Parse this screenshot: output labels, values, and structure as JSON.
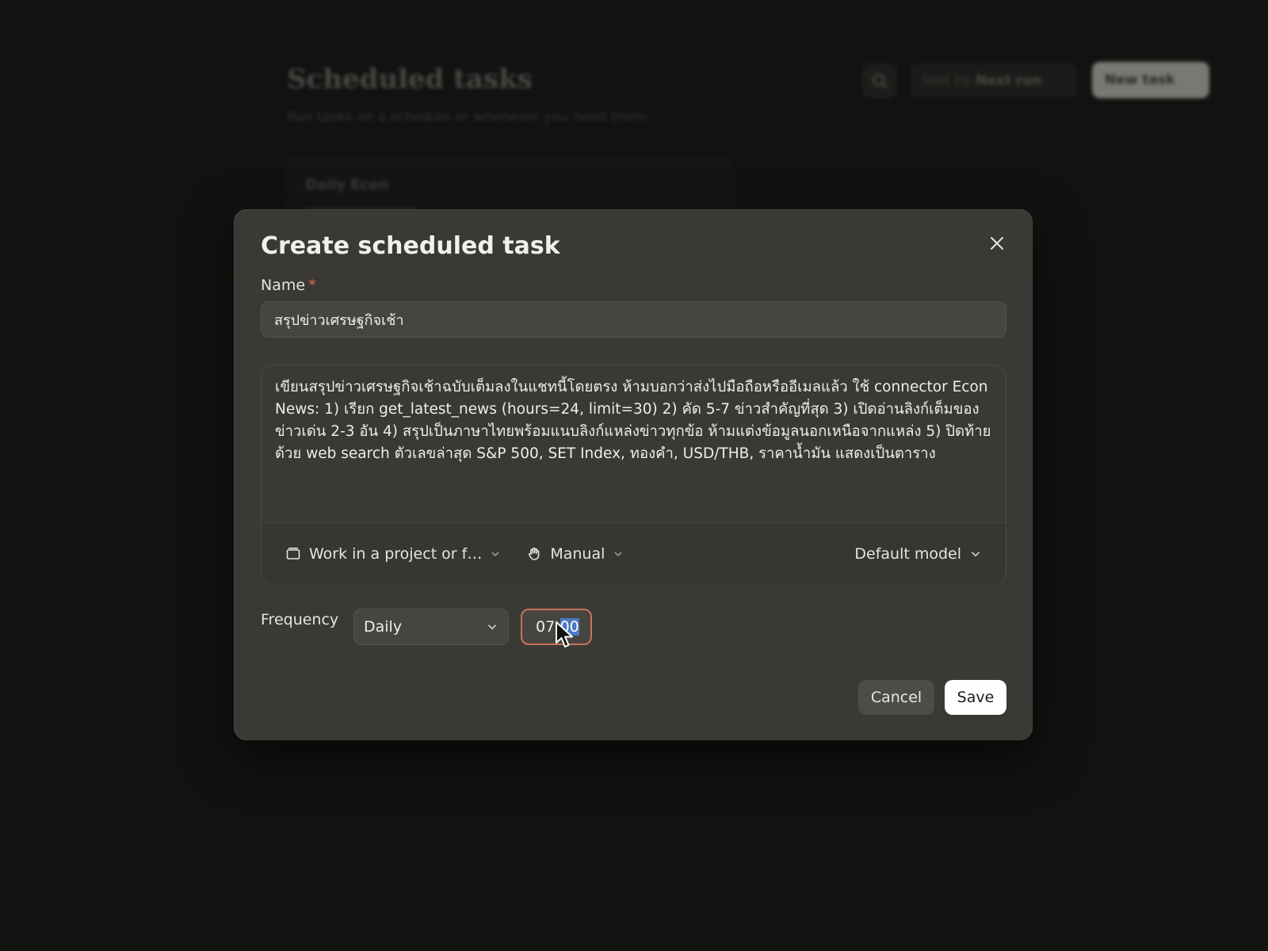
{
  "background": {
    "title": "Scheduled tasks",
    "subtitle": "Run tasks on a schedule or whenever you need them.",
    "sort_prefix": "Sort by",
    "sort_value": "Next run",
    "new_task_label": "New task",
    "card_title": "Daily Econ"
  },
  "modal": {
    "title": "Create scheduled task",
    "name_label": "Name",
    "required_marker": "*",
    "name_value": "สรุปข่าวเศรษฐกิจเช้า",
    "prompt_value": "เขียนสรุปข่าวเศรษฐกิจเช้าฉบับเต็มลงในแชทนี้โดยตรง ห้ามบอกว่าส่งไปมือถือหรืออีเมลแล้ว ใช้ connector Econ News: 1) เรียก get_latest_news (hours=24, limit=30) 2) คัด 5-7 ข่าวสำคัญที่สุด 3) เปิดอ่านลิงก์เต็มของข่าวเด่น 2-3 อัน 4) สรุปเป็นภาษาไทยพร้อมแนบลิงก์แหล่งข่าวทุกข้อ ห้ามแต่งข้อมูลนอกเหนือจากแหล่ง 5) ปิดท้ายด้วย web search ตัวเลขล่าสุด S&P 500, SET Index, ทองคำ, USD/THB, ราคาน้ำมัน แสดงเป็นตาราง",
    "toolbar": {
      "folder_label": "Work in a project or f…",
      "permission_label": "Manual",
      "model_label": "Default model"
    },
    "frequency_label": "Frequency",
    "frequency_value": "Daily",
    "time_hour": "07",
    "time_sep": ":",
    "time_minute": "00",
    "cancel_label": "Cancel",
    "save_label": "Save"
  },
  "icons": {
    "close": "close-icon",
    "folder": "folder-icon",
    "permission": "hand-icon",
    "chevron": "chevron-down-icon",
    "search": "search-icon",
    "cursor": "mouse-cursor-icon"
  },
  "colors": {
    "modal_bg": "#3a3935",
    "accent_focus": "#c8735f",
    "selection": "#4b79c2",
    "required": "#d96e5c"
  }
}
